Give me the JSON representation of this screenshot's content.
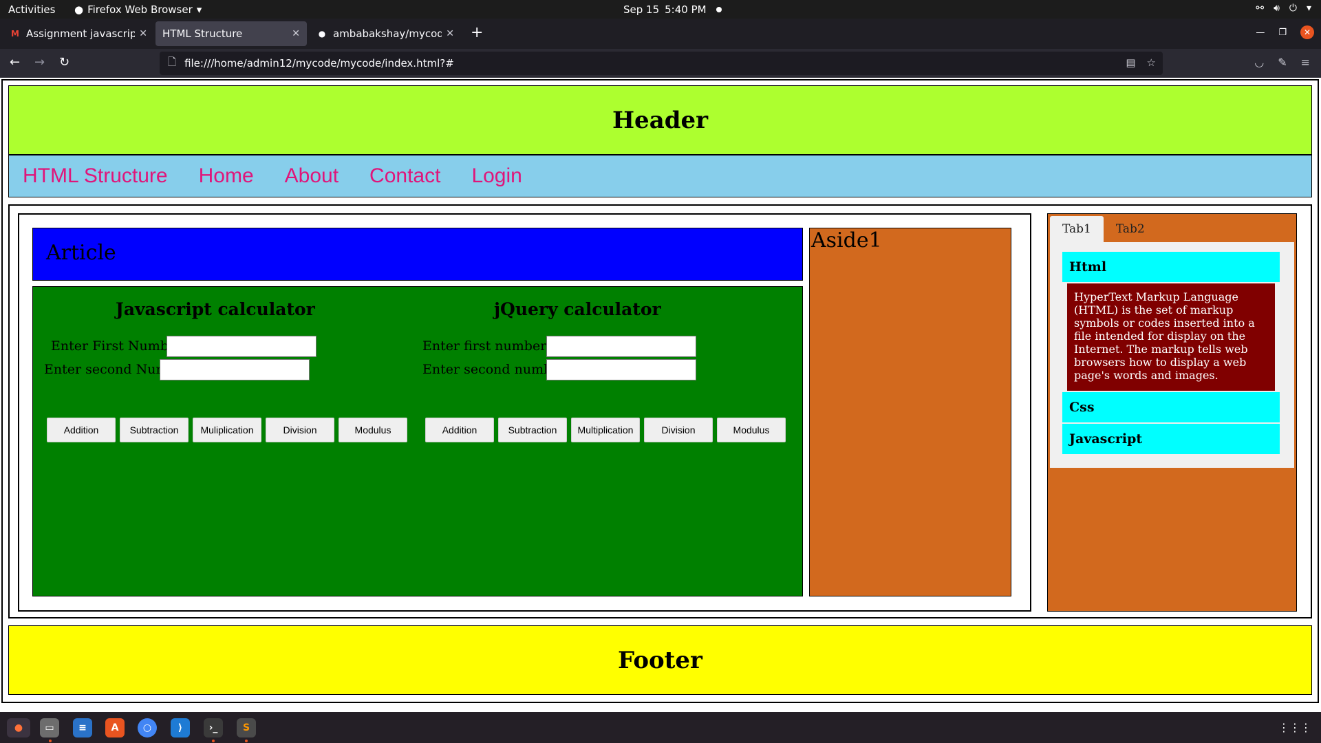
{
  "topbar": {
    "activities": "Activities",
    "app_name": "Firefox Web Browser",
    "date": "Sep 15",
    "time": "5:40 PM"
  },
  "browser": {
    "tabs": [
      {
        "title": "Assignment javascript and",
        "favicon": "gmail-icon"
      },
      {
        "title": "HTML Structure",
        "favicon": "none"
      },
      {
        "title": "ambabakshay/mycode",
        "favicon": "github-icon"
      }
    ],
    "url": "file:///home/admin12/mycode/mycode/index.html?#"
  },
  "page": {
    "header": "Header",
    "nav": [
      "HTML Structure",
      "Home",
      "About",
      "Contact",
      "Login"
    ],
    "article_title": "Article",
    "js_calc": {
      "title": "Javascript calculator",
      "first_label": "Enter First Number",
      "second_label": "Enter second Number",
      "buttons": [
        "Addition",
        "Subtraction",
        "Muliplication",
        "Division",
        "Modulus"
      ]
    },
    "jq_calc": {
      "title": "jQuery calculator",
      "first_label": "Enter first number",
      "second_label": "Enter second number",
      "buttons": [
        "Addition",
        "Subtraction",
        "Multiplication",
        "Division",
        "Modulus"
      ]
    },
    "aside1": "Aside1",
    "tabs": {
      "tab1": "Tab1",
      "tab2": "Tab2",
      "sections": [
        "Html",
        "Css",
        "Javascript"
      ],
      "html_text": "HyperText Markup Language (HTML) is the set of markup symbols or codes inserted into a file intended for display on the Internet. The markup tells web browsers how to display a web page's words and images."
    },
    "footer": "Footer"
  },
  "colors": {
    "header": "#adff2f",
    "nav": "#87ceeb",
    "nav_link": "#e0157a",
    "article_head": "#0000ff",
    "calc_bg": "#008000",
    "aside": "#d2691e",
    "accordion_header": "#00ffff",
    "accordion_body": "#800000",
    "footer": "#ffff00"
  }
}
